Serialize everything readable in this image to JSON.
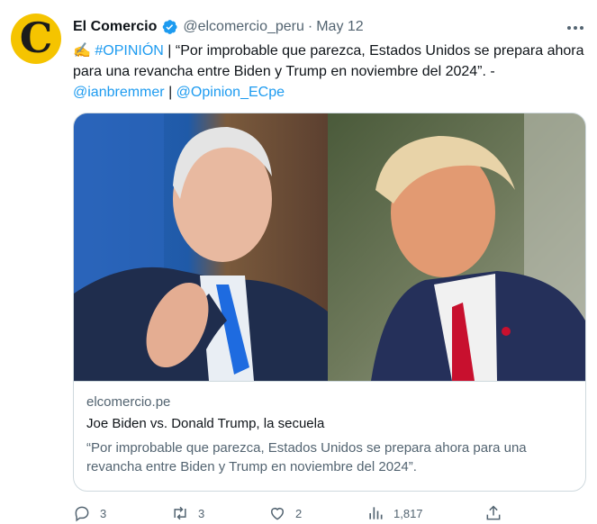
{
  "author": {
    "avatar_letter": "C",
    "name": "El Comercio",
    "handle": "@elcomercio_peru",
    "separator": "·",
    "date": "May 12"
  },
  "tweet": {
    "emoji": "✍️",
    "hashtag": "#OPINIÓN",
    "pipe": "|",
    "body": "“Por improbable que parezca, Estados Unidos se prepara ahora para una revancha entre Biden y Trump en noviembre del 2024”. -",
    "mention1": "@ianbremmer",
    "mention_sep": "|",
    "mention2": "@Opinion_ECpe"
  },
  "card": {
    "domain": "elcomercio.pe",
    "title": "Joe Biden vs. Donald Trump, la secuela",
    "description": "“Por improbable que parezca, Estados Unidos se prepara ahora para una revancha entre Biden y Trump en noviembre del 2024”."
  },
  "actions": {
    "replies": "3",
    "retweets": "3",
    "likes": "2",
    "views": "1,817"
  },
  "colors": {
    "link": "#1d9bf0",
    "secondary_text": "#536471",
    "avatar_bg": "#f5c400",
    "border": "#cfd9de"
  },
  "icons": [
    "verified-badge-icon",
    "more-icon",
    "reply-icon",
    "retweet-icon",
    "like-icon",
    "views-icon",
    "share-icon"
  ]
}
